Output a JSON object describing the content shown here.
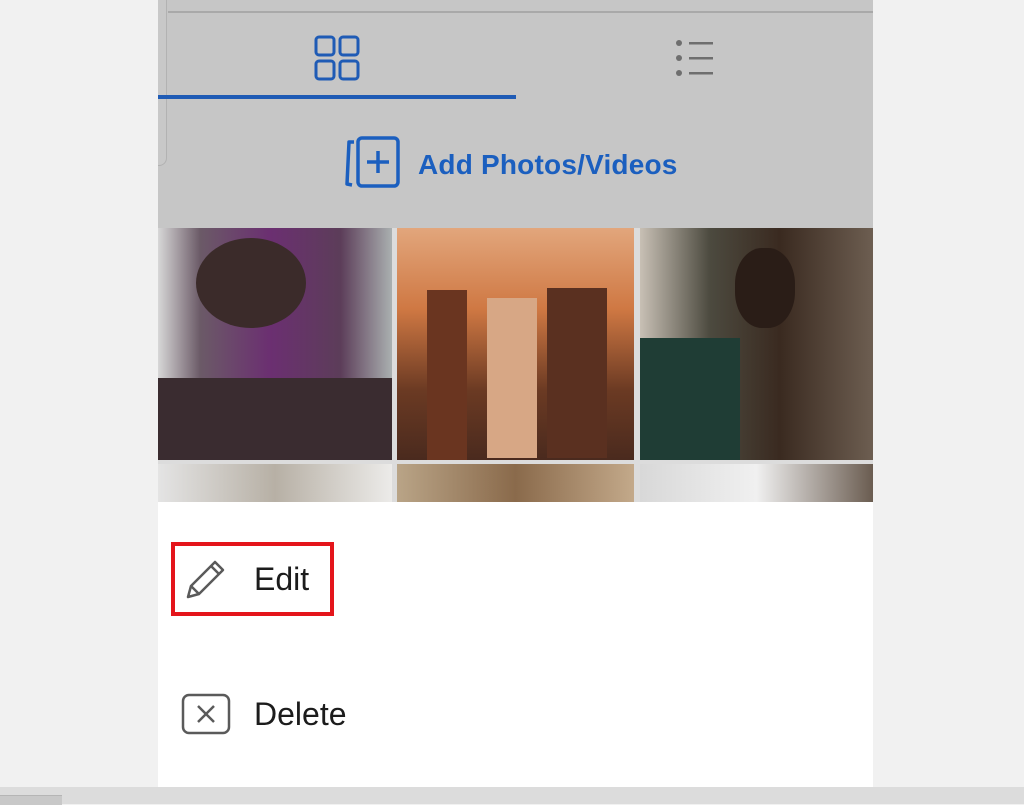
{
  "tabs": [
    {
      "name": "grid",
      "icon": "grid-icon",
      "selected": true
    },
    {
      "name": "list",
      "icon": "list-icon",
      "selected": false
    }
  ],
  "add_button": {
    "label": "Add Photos/Videos",
    "icon": "add-photo-icon"
  },
  "menu": {
    "edit_label": "Edit",
    "delete_label": "Delete"
  },
  "colors": {
    "accent": "#1b5fbf",
    "highlight": "#e4151b",
    "overlay": "#c6c6c6",
    "text": "#1c1c1c"
  }
}
